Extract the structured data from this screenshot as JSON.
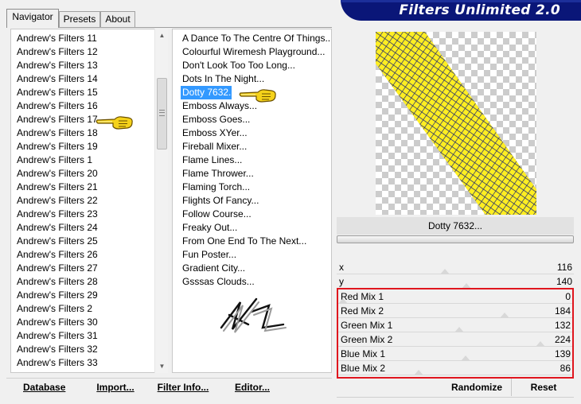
{
  "tabs": [
    {
      "label": "Navigator",
      "active": true
    },
    {
      "label": "Presets",
      "active": false
    },
    {
      "label": "About",
      "active": false
    }
  ],
  "banner": {
    "title": "Filters Unlimited 2.0",
    "color": "#0a1678"
  },
  "categories": [
    "Andrew's Filters 11",
    "Andrew's Filters 12",
    "Andrew's Filters 13",
    "Andrew's Filters 14",
    "Andrew's Filters 15",
    "Andrew's Filters 16",
    "Andrew's Filters 17",
    "Andrew's Filters 18",
    "Andrew's Filters 19",
    "Andrew's Filters 1",
    "Andrew's Filters 20",
    "Andrew's Filters 21",
    "Andrew's Filters 22",
    "Andrew's Filters 23",
    "Andrew's Filters 24",
    "Andrew's Filters 25",
    "Andrew's Filters 26",
    "Andrew's Filters 27",
    "Andrew's Filters 28",
    "Andrew's Filters 29",
    "Andrew's Filters 2",
    "Andrew's Filters 30",
    "Andrew's Filters 31",
    "Andrew's Filters 32",
    "Andrew's Filters 33"
  ],
  "filters": [
    "A Dance To The Centre Of Things...",
    "Colourful Wiremesh Playground...",
    "Don't Look Too Too Long...",
    "Dots In The Night...",
    "Dotty 7632...",
    "Emboss Always...",
    "Emboss Goes...",
    "Emboss XYer...",
    "Fireball Mixer...",
    "Flame Lines...",
    "Flame Thrower...",
    "Flaming Torch...",
    "Flights Of Fancy...",
    "Follow Course...",
    "Freaky Out...",
    "From One End To The Next...",
    "Fun Poster...",
    "Gradient City...",
    "Gsssas Clouds..."
  ],
  "selected_filter": "Dotty 7632...",
  "preview": {
    "filter_name": "Dotty 7632..."
  },
  "params": {
    "x": {
      "label": "x",
      "value": "116",
      "max": 255
    },
    "y": {
      "label": "y",
      "value": "140",
      "max": 255
    },
    "red_mix_1": {
      "label": "Red Mix 1",
      "value": "0",
      "max": 255
    },
    "red_mix_2": {
      "label": "Red Mix 2",
      "value": "184",
      "max": 255
    },
    "green_mix_1": {
      "label": "Green Mix 1",
      "value": "132",
      "max": 255
    },
    "green_mix_2": {
      "label": "Green Mix 2",
      "value": "224",
      "max": 255
    },
    "blue_mix_1": {
      "label": "Blue Mix 1",
      "value": "139",
      "max": 255
    },
    "blue_mix_2": {
      "label": "Blue Mix 2",
      "value": "86",
      "max": 255
    }
  },
  "buttons": {
    "database": "Database",
    "import": "Import...",
    "filter_info": "Filter Info...",
    "editor": "Editor...",
    "randomize": "Randomize",
    "reset": "Reset"
  },
  "colors": {
    "selection": "#3399ff",
    "highlight_border": "#e0161e",
    "dot_fill": "#ffee22",
    "mesh_line": "#1e2a6e"
  }
}
